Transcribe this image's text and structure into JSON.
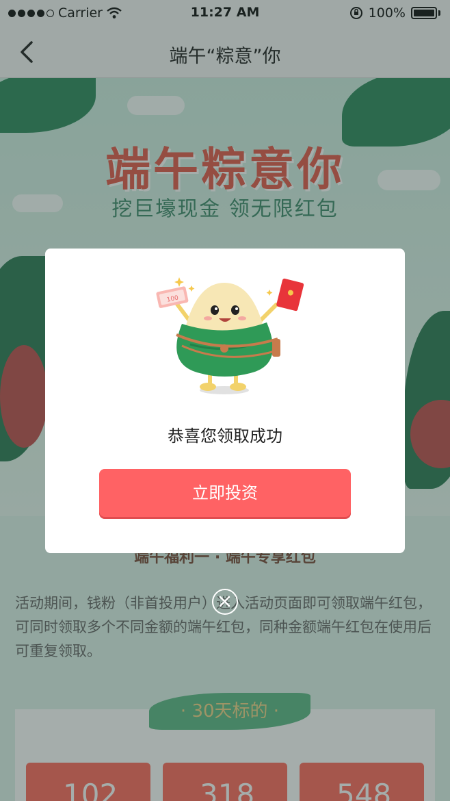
{
  "status_bar": {
    "carrier": "Carrier",
    "time": "11:27 AM",
    "battery": "100%"
  },
  "nav": {
    "title": "端午“粽意”你"
  },
  "banner": {
    "title": "端午粽意你",
    "subtitle": "挖巨壕现金  领无限红包"
  },
  "section": {
    "title": "端午福利一 · 端午专享红包",
    "description": "活动期间，钱粉（非首投用户）进入活动页面即可领取端午红包，可同时领取多个不同金额的端午红包，同种金额端午红包在使用后可重复领取。"
  },
  "product": {
    "tag": "· 30天标的 ·",
    "cards": [
      {
        "currency": "¥",
        "amount": "102"
      },
      {
        "currency": "¥",
        "amount": "318"
      },
      {
        "currency": "¥",
        "amount": "548"
      }
    ]
  },
  "modal": {
    "ticket_text": "100",
    "message": "恭喜您领取成功",
    "button_label": "立即投资"
  },
  "colors": {
    "accent": "#ff6264",
    "overlay": "rgba(40,60,55,0.42)"
  }
}
